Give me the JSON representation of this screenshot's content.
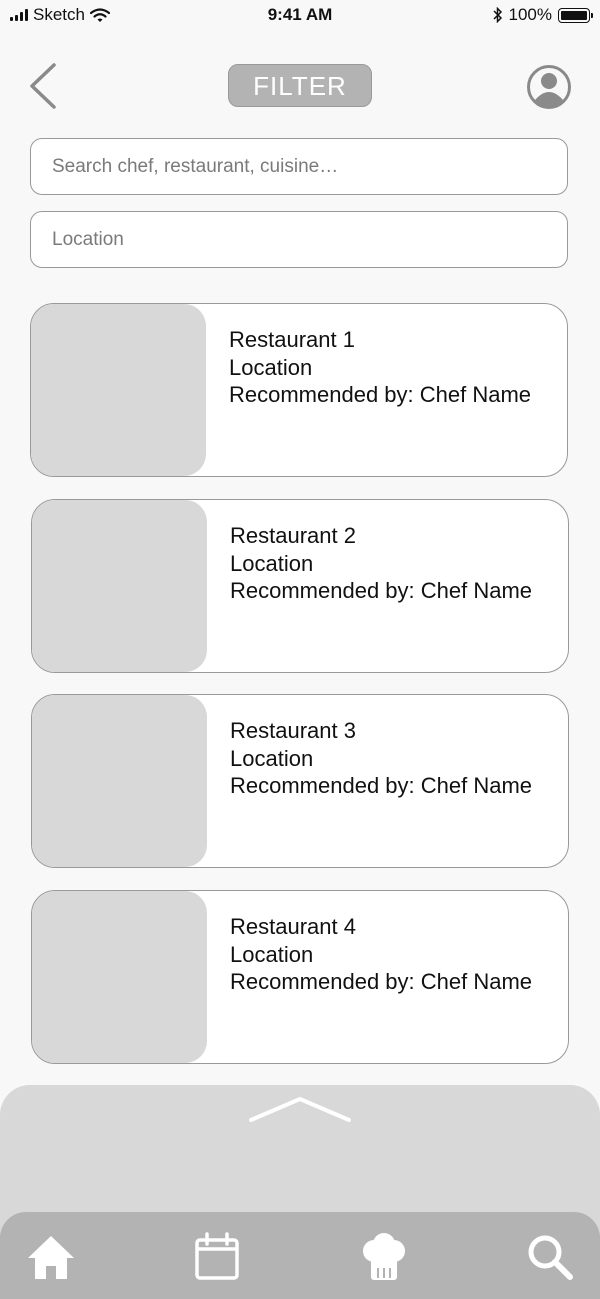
{
  "status_bar": {
    "carrier": "Sketch",
    "time": "9:41 AM",
    "battery": "100%"
  },
  "header": {
    "back_icon": "chevron-left-icon",
    "filter_label": "FILTER",
    "profile_icon": "user-circle-icon"
  },
  "search": {
    "placeholder": "Search chef, restaurant, cuisine…",
    "value": ""
  },
  "location": {
    "placeholder": "Location",
    "value": ""
  },
  "restaurants": [
    {
      "name": "Restaurant 1",
      "location": "Location",
      "recommended": "Recommended by: Chef Name"
    },
    {
      "name": "Restaurant 2",
      "location": "Location",
      "recommended": "Recommended by: Chef Name"
    },
    {
      "name": "Restaurant 3",
      "location": "Location",
      "recommended": "Recommended by: Chef Name"
    },
    {
      "name": "Restaurant 4",
      "location": "Location",
      "recommended": "Recommended by: Chef Name"
    }
  ],
  "tab_bar": {
    "icons": [
      "home-icon",
      "calendar-icon",
      "chef-hat-icon",
      "search-icon"
    ]
  },
  "colors": {
    "placeholder_gray": "#d8d8d8",
    "button_gray": "#b3b3b3",
    "border_gray": "#999999"
  }
}
